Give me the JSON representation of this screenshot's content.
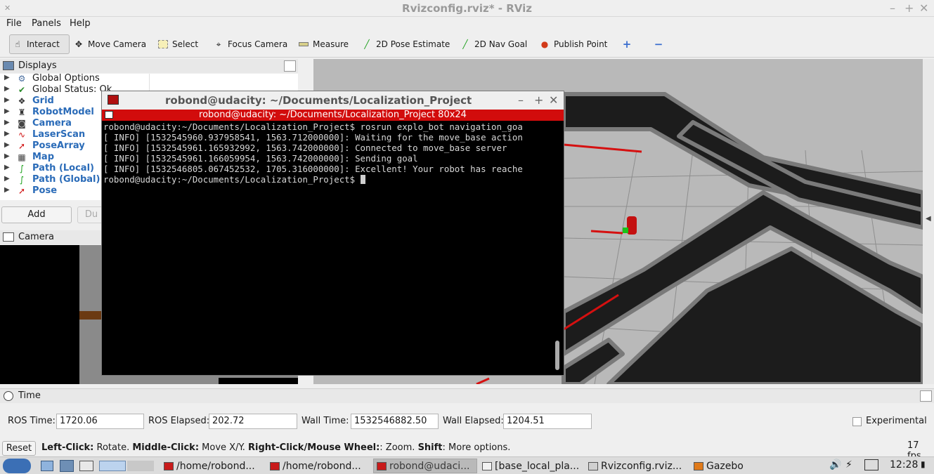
{
  "window": {
    "title": "Rvizconfig.rviz* - RViz"
  },
  "menu": [
    "File",
    "Panels",
    "Help"
  ],
  "toolbar": {
    "interact": "Interact",
    "move_camera": "Move Camera",
    "select": "Select",
    "focus_camera": "Focus Camera",
    "measure": "Measure",
    "pose_estimate": "2D Pose Estimate",
    "nav_goal": "2D Nav Goal",
    "publish_point": "Publish Point"
  },
  "displays": {
    "title": "Displays",
    "items": [
      {
        "label": "Global Options",
        "icon": "gear-icon"
      },
      {
        "label": "Global Status: Ok",
        "icon": "check-icon"
      },
      {
        "label": "Grid",
        "icon": "grid-icon"
      },
      {
        "label": "RobotModel",
        "icon": "robot-icon"
      },
      {
        "label": "Camera",
        "icon": "camera-icon"
      },
      {
        "label": "LaserScan",
        "icon": "laserscan-icon"
      },
      {
        "label": "PoseArray",
        "icon": "posearray-icon"
      },
      {
        "label": "Map",
        "icon": "map-icon"
      },
      {
        "label": "Path (Local)",
        "icon": "path-icon"
      },
      {
        "label": "Path (Global)",
        "icon": "path-icon"
      },
      {
        "label": "Pose",
        "icon": "pose-icon"
      }
    ],
    "add": "Add",
    "duplicate": "Du"
  },
  "camera_panel": {
    "title": "Camera"
  },
  "terminal": {
    "title": "robond@udacity: ~/Documents/Localization_Project",
    "tab": "robond@udacity: ~/Documents/Localization_Project 80x24",
    "lines": [
      "robond@udacity:~/Documents/Localization_Project$ rosrun explo_bot navigation_goa",
      "[ INFO] [1532545960.937958541, 1563.712000000]: Waiting for the move_base action",
      "[ INFO] [1532545961.165932992, 1563.742000000]: Connected to move_base server",
      "[ INFO] [1532545961.166059954, 1563.742000000]: Sending goal",
      "[ INFO] [1532546805.067452532, 1705.316000000]: Excellent! Your robot has reache",
      "robond@udacity:~/Documents/Localization_Project$ "
    ]
  },
  "time": {
    "title": "Time",
    "ros_time_label": "ROS Time:",
    "ros_time": "1720.06",
    "ros_elapsed_label": "ROS Elapsed:",
    "ros_elapsed": "202.72",
    "wall_time_label": "Wall Time:",
    "wall_time": "1532546882.50",
    "wall_elapsed_label": "Wall Elapsed:",
    "wall_elapsed": "1204.51",
    "experimental": "Experimental"
  },
  "status": {
    "reset": "Reset",
    "b1": "Left-Click:",
    "t1": " Rotate. ",
    "b2": "Middle-Click:",
    "t2": " Move X/Y. ",
    "b3": "Right-Click/Mouse Wheel:",
    "t3": ": Zoom. ",
    "b4": "Shift",
    "t4": ": More options.",
    "fps": "17 fps"
  },
  "taskbar": {
    "tasks": [
      "/home/robond...",
      "/home/robond...",
      "robond@udaci...",
      "[base_local_pla...",
      "Rvizconfig.rviz...",
      "Gazebo"
    ],
    "clock": "12:28"
  },
  "colors": {
    "accent_red": "#d20c0c",
    "terminal_bg": "#000000",
    "link_blue": "#2a6bb8"
  }
}
